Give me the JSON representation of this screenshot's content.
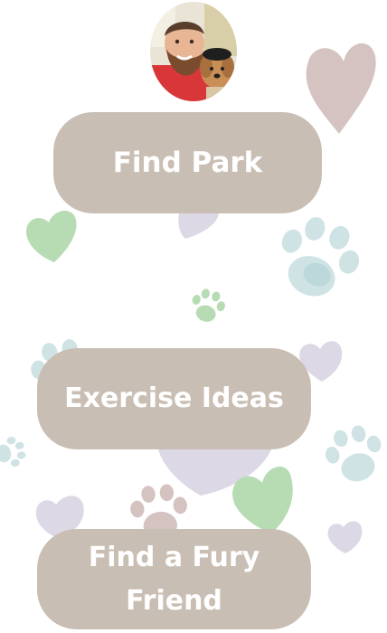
{
  "profile": {
    "avatar_icon": "profile-photo-man-with-dog"
  },
  "menu": {
    "find_park_label": "Find Park",
    "exercise_ideas_label": "Exercise Ideas",
    "find_friend_label": "Find a Fury Friend"
  },
  "colors": {
    "button_bg": "#c9beb3",
    "button_text": "#ffffff",
    "heart_pink": "#d5c3c1",
    "heart_green": "#b7dcb3",
    "heart_lavender": "#dcd8e6",
    "paw_teal": "#cfe3e5"
  }
}
